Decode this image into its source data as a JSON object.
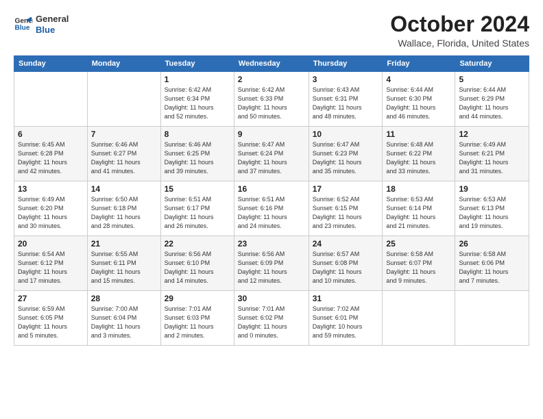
{
  "logo": {
    "line1": "General",
    "line2": "Blue"
  },
  "title": "October 2024",
  "subtitle": "Wallace, Florida, United States",
  "days_of_week": [
    "Sunday",
    "Monday",
    "Tuesday",
    "Wednesday",
    "Thursday",
    "Friday",
    "Saturday"
  ],
  "weeks": [
    [
      {
        "day": "",
        "info": ""
      },
      {
        "day": "",
        "info": ""
      },
      {
        "day": "1",
        "info": "Sunrise: 6:42 AM\nSunset: 6:34 PM\nDaylight: 11 hours\nand 52 minutes."
      },
      {
        "day": "2",
        "info": "Sunrise: 6:42 AM\nSunset: 6:33 PM\nDaylight: 11 hours\nand 50 minutes."
      },
      {
        "day": "3",
        "info": "Sunrise: 6:43 AM\nSunset: 6:31 PM\nDaylight: 11 hours\nand 48 minutes."
      },
      {
        "day": "4",
        "info": "Sunrise: 6:44 AM\nSunset: 6:30 PM\nDaylight: 11 hours\nand 46 minutes."
      },
      {
        "day": "5",
        "info": "Sunrise: 6:44 AM\nSunset: 6:29 PM\nDaylight: 11 hours\nand 44 minutes."
      }
    ],
    [
      {
        "day": "6",
        "info": "Sunrise: 6:45 AM\nSunset: 6:28 PM\nDaylight: 11 hours\nand 42 minutes."
      },
      {
        "day": "7",
        "info": "Sunrise: 6:46 AM\nSunset: 6:27 PM\nDaylight: 11 hours\nand 41 minutes."
      },
      {
        "day": "8",
        "info": "Sunrise: 6:46 AM\nSunset: 6:25 PM\nDaylight: 11 hours\nand 39 minutes."
      },
      {
        "day": "9",
        "info": "Sunrise: 6:47 AM\nSunset: 6:24 PM\nDaylight: 11 hours\nand 37 minutes."
      },
      {
        "day": "10",
        "info": "Sunrise: 6:47 AM\nSunset: 6:23 PM\nDaylight: 11 hours\nand 35 minutes."
      },
      {
        "day": "11",
        "info": "Sunrise: 6:48 AM\nSunset: 6:22 PM\nDaylight: 11 hours\nand 33 minutes."
      },
      {
        "day": "12",
        "info": "Sunrise: 6:49 AM\nSunset: 6:21 PM\nDaylight: 11 hours\nand 31 minutes."
      }
    ],
    [
      {
        "day": "13",
        "info": "Sunrise: 6:49 AM\nSunset: 6:20 PM\nDaylight: 11 hours\nand 30 minutes."
      },
      {
        "day": "14",
        "info": "Sunrise: 6:50 AM\nSunset: 6:18 PM\nDaylight: 11 hours\nand 28 minutes."
      },
      {
        "day": "15",
        "info": "Sunrise: 6:51 AM\nSunset: 6:17 PM\nDaylight: 11 hours\nand 26 minutes."
      },
      {
        "day": "16",
        "info": "Sunrise: 6:51 AM\nSunset: 6:16 PM\nDaylight: 11 hours\nand 24 minutes."
      },
      {
        "day": "17",
        "info": "Sunrise: 6:52 AM\nSunset: 6:15 PM\nDaylight: 11 hours\nand 23 minutes."
      },
      {
        "day": "18",
        "info": "Sunrise: 6:53 AM\nSunset: 6:14 PM\nDaylight: 11 hours\nand 21 minutes."
      },
      {
        "day": "19",
        "info": "Sunrise: 6:53 AM\nSunset: 6:13 PM\nDaylight: 11 hours\nand 19 minutes."
      }
    ],
    [
      {
        "day": "20",
        "info": "Sunrise: 6:54 AM\nSunset: 6:12 PM\nDaylight: 11 hours\nand 17 minutes."
      },
      {
        "day": "21",
        "info": "Sunrise: 6:55 AM\nSunset: 6:11 PM\nDaylight: 11 hours\nand 15 minutes."
      },
      {
        "day": "22",
        "info": "Sunrise: 6:56 AM\nSunset: 6:10 PM\nDaylight: 11 hours\nand 14 minutes."
      },
      {
        "day": "23",
        "info": "Sunrise: 6:56 AM\nSunset: 6:09 PM\nDaylight: 11 hours\nand 12 minutes."
      },
      {
        "day": "24",
        "info": "Sunrise: 6:57 AM\nSunset: 6:08 PM\nDaylight: 11 hours\nand 10 minutes."
      },
      {
        "day": "25",
        "info": "Sunrise: 6:58 AM\nSunset: 6:07 PM\nDaylight: 11 hours\nand 9 minutes."
      },
      {
        "day": "26",
        "info": "Sunrise: 6:58 AM\nSunset: 6:06 PM\nDaylight: 11 hours\nand 7 minutes."
      }
    ],
    [
      {
        "day": "27",
        "info": "Sunrise: 6:59 AM\nSunset: 6:05 PM\nDaylight: 11 hours\nand 5 minutes."
      },
      {
        "day": "28",
        "info": "Sunrise: 7:00 AM\nSunset: 6:04 PM\nDaylight: 11 hours\nand 3 minutes."
      },
      {
        "day": "29",
        "info": "Sunrise: 7:01 AM\nSunset: 6:03 PM\nDaylight: 11 hours\nand 2 minutes."
      },
      {
        "day": "30",
        "info": "Sunrise: 7:01 AM\nSunset: 6:02 PM\nDaylight: 11 hours\nand 0 minutes."
      },
      {
        "day": "31",
        "info": "Sunrise: 7:02 AM\nSunset: 6:01 PM\nDaylight: 10 hours\nand 59 minutes."
      },
      {
        "day": "",
        "info": ""
      },
      {
        "day": "",
        "info": ""
      }
    ]
  ]
}
